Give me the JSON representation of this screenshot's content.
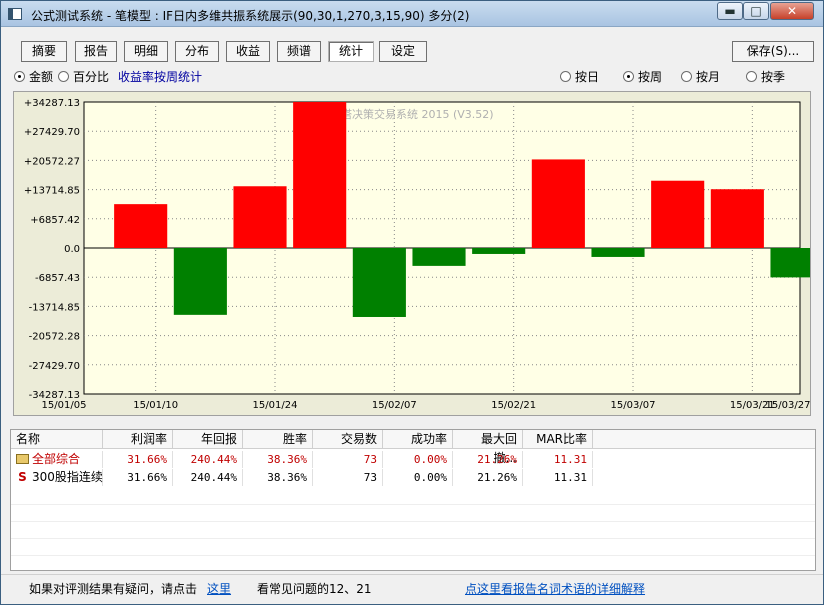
{
  "window": {
    "title": "公式测试系统 - 笔模型 : IF日内多维共振系统展示(90,30,1,270,3,15,90) 多分(2)",
    "min_label": "▬",
    "max_label": "□",
    "close_label": "✕"
  },
  "toolbar": {
    "tabs": [
      {
        "label": "摘要"
      },
      {
        "label": "报告"
      },
      {
        "label": "明细"
      },
      {
        "label": "分布"
      },
      {
        "label": "收益"
      },
      {
        "label": "频谱"
      },
      {
        "label": "统计",
        "active": true
      },
      {
        "label": "设定"
      }
    ],
    "save_label": "保存(S)..."
  },
  "mode_options": {
    "amount": "金额",
    "percent": "百分比",
    "selected": "amount",
    "period_link": "收益率按周统计"
  },
  "period_options": {
    "day": "按日",
    "week": "按周",
    "month": "按月",
    "season": "按季",
    "selected": "week"
  },
  "chart_data": {
    "type": "bar",
    "watermark": "字塔决策交易系统 2015 (V3.52)",
    "ylim": [
      -34287.13,
      34287.13
    ],
    "yticks": [
      "+34287.13",
      "+27429.70",
      "+20572.27",
      "+13714.85",
      "+6857.42",
      "0.0",
      "-6857.43",
      "-13714.85",
      "-20572.28",
      "-27429.70",
      "-34287.13"
    ],
    "xticks": [
      "15/01/05",
      "15/01/10",
      "15/01/24",
      "15/02/07",
      "15/02/21",
      "15/03/07",
      "15/03/21",
      "15/03/27"
    ],
    "values": [
      10300,
      -15700,
      14500,
      34287,
      -16200,
      -4200,
      -1400,
      20800,
      -2100,
      15800,
      13800,
      -6900
    ],
    "positive_color": "#ff0000",
    "negative_color": "#008000",
    "grid": true
  },
  "table": {
    "columns": [
      "名称",
      "利润率",
      "年回报",
      "胜率",
      "交易数",
      "成功率",
      "最大回撤...",
      "MAR比率"
    ],
    "rows": [
      {
        "name": "全部综合",
        "icon": "folder-icon",
        "highlight": true,
        "values": [
          "31.66%",
          "240.44%",
          "38.36%",
          "73",
          "0.00%",
          "21.26%",
          "11.31"
        ]
      },
      {
        "name": "300股指连续",
        "icon": "s-icon",
        "icon_text": "S",
        "highlight": false,
        "values": [
          "31.66%",
          "240.44%",
          "38.36%",
          "73",
          "0.00%",
          "21.26%",
          "11.31"
        ]
      }
    ]
  },
  "footer": {
    "question_text": "如果对评测结果有疑问，请点击",
    "here_link": "这里",
    "faq_text": "看常见问题的12、21",
    "glossary_link": "点这里看报告名词术语的详细解释"
  }
}
